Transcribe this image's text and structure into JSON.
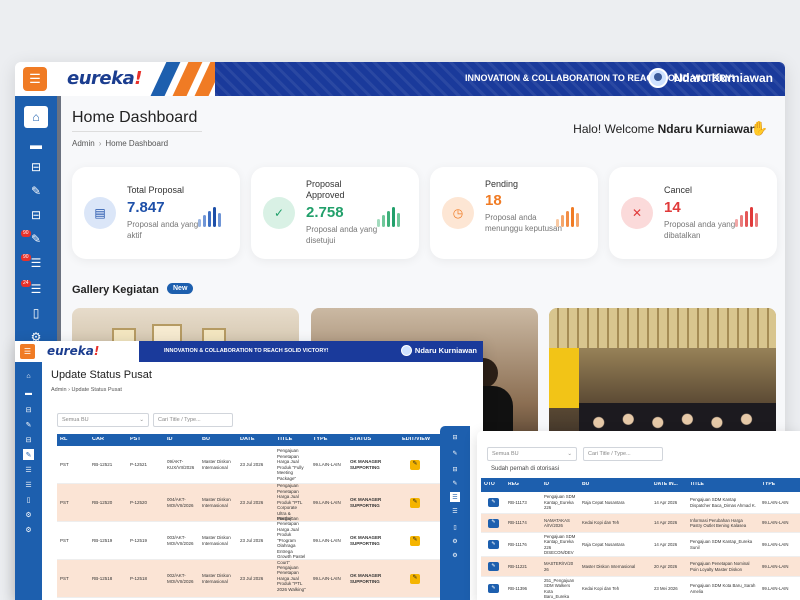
{
  "app": {
    "logo": "eureka",
    "logo_mark": "!",
    "banner": "INNOVATION & COLLABORATION TO REACH SOLID VICTORY!",
    "user_name": "Ndaru Kurniawan"
  },
  "dashboard": {
    "title": "Home Dashboard",
    "breadcrumb": [
      "Admin",
      "Home Dashboard"
    ],
    "welcome_prefix": "Halo! Welcome",
    "welcome_name": "Ndaru Kurniawan",
    "cards": [
      {
        "title": "Total Proposal",
        "value": "7.847",
        "desc": "Proposal anda yang aktif",
        "color": "#1d4fa8",
        "icon": "document-icon",
        "level": 1.0
      },
      {
        "title": "Proposal Approved",
        "value": "2.758",
        "desc": "Proposal anda yang disetujui",
        "color": "#22a06b",
        "icon": "check-circle-icon",
        "level": 1.0
      },
      {
        "title": "Pending",
        "value": "18",
        "desc": "Proposal anda menunggu keputusan",
        "color": "#f07b24",
        "icon": "clock-icon",
        "level": 1.0
      },
      {
        "title": "Cancel",
        "value": "14",
        "desc": "Proposal anda yang dibatalkan",
        "color": "#e03a3a",
        "icon": "x-circle-icon",
        "level": 1.0
      }
    ],
    "gallery_title": "Gallery Kegiatan",
    "gallery_badge": "New",
    "sidebar_badges": [
      "90",
      "90",
      "24"
    ]
  },
  "update_status": {
    "title": "Update Status Pusat",
    "breadcrumb": [
      "Admin",
      "Update Status Pusat"
    ],
    "filter_bu_placeholder": "Semua BU",
    "search_placeholder": "Cari Title / Type...",
    "columns": [
      "RL",
      "CAR",
      "PST",
      "ID",
      "BU",
      "DATE",
      "TITLE",
      "TYPE",
      "STATUS",
      "EDIT/VIEW"
    ],
    "rows": [
      [
        "PST",
        "RB-12521",
        "P-12521",
        "09/AKT-KUX/VII/2026",
        "Master Diskon Internasional",
        "23 Jul 2026",
        "Pengajuan Penetapan Harga Jual Produk \"Fully Meeting Package\"",
        "99.LAIN-LAIN",
        "OK MANAGER SUPPORTING"
      ],
      [
        "PST",
        "RB-12520",
        "P-12520",
        "004/AKT-MOI/VII/2026",
        "Master Diskon Internasional",
        "23 Jul 2026",
        "Pengajuan Penetapan Harga Jual Produk \"PTL Corporate Ultra & Marthe\"",
        "99.LAIN-LAIN",
        "OK MANAGER SUPPORTING"
      ],
      [
        "PST",
        "RB-12519",
        "P-12519",
        "003/AKT-MOI/VII/2026",
        "Master Diskon Internasional",
        "23 Jul 2026",
        "Pengajuan Penetapan Harga Jual Produk \"Program Olahraga Entrega Growth Pastel Court\"",
        "99.LAIN-LAIN",
        "OK MANAGER SUPPORTING"
      ],
      [
        "PST",
        "RB-12518",
        "P-12518",
        "002/AKT-MOI/VII/2026",
        "Master Diskon Internasional",
        "23 Jul 2026",
        "Pengajuan Penetapan Harga Jual Produk \"PTL 2026 Walking\"",
        "99.LAIN-LAIN",
        "OK MANAGER SUPPORTING"
      ]
    ]
  },
  "authorization": {
    "filter_bu_placeholder": "Semua BU",
    "search_placeholder": "Cari Title / Type...",
    "section": "Sudah pernah di otorisasi",
    "columns": [
      "OTO",
      "REG",
      "ID",
      "BU",
      "DATE IN...",
      "TITLE",
      "TYPE"
    ],
    "rows": [
      [
        "RB-11173",
        "Pengajuan SDM Kantap_Eureka 226",
        "Raja Cepat Nusantara",
        "14 Apr 2026",
        "Pengajuan SDM Kantap Dispatcher Baca_Dimas Ahmad K.",
        "99.LAIN-LAIN"
      ],
      [
        "RB-11174",
        "NAMATAKAS A/IV/2026",
        "Kedai Kopi dan Teh",
        "14 Apr 2026",
        "Informasi Perubahan Harga Pastry Outlet Bening Kalasea",
        "99.LAIN-LAIN"
      ],
      [
        "RB-11176",
        "Pengajuan SDM Kantap_Eureka 226 DISECON/DEV",
        "Raja Cepat Nusantara",
        "14 Apr 2026",
        "Pengajuan SDM Kantap_Eureka Sunil",
        "99.LAIN-LAIN"
      ],
      [
        "RB-11221",
        "MASTER/IV/20 26",
        "Master Diskon Internasional",
        "20 Apr 2026",
        "Pengajuan Penetapan Nominal Poin Loyalty Master Diskon",
        "99.LAIN-LAIN"
      ],
      [
        "RB-11396",
        "251_Pengajuan SDM Walkers Kota Baru_Eureka",
        "Kedai Kopi dan Teh",
        "23 Mei 2026",
        "Pengajuan SDM Kota Baru_Sarah Amelia",
        "99.LAIN-LAIN"
      ]
    ]
  }
}
